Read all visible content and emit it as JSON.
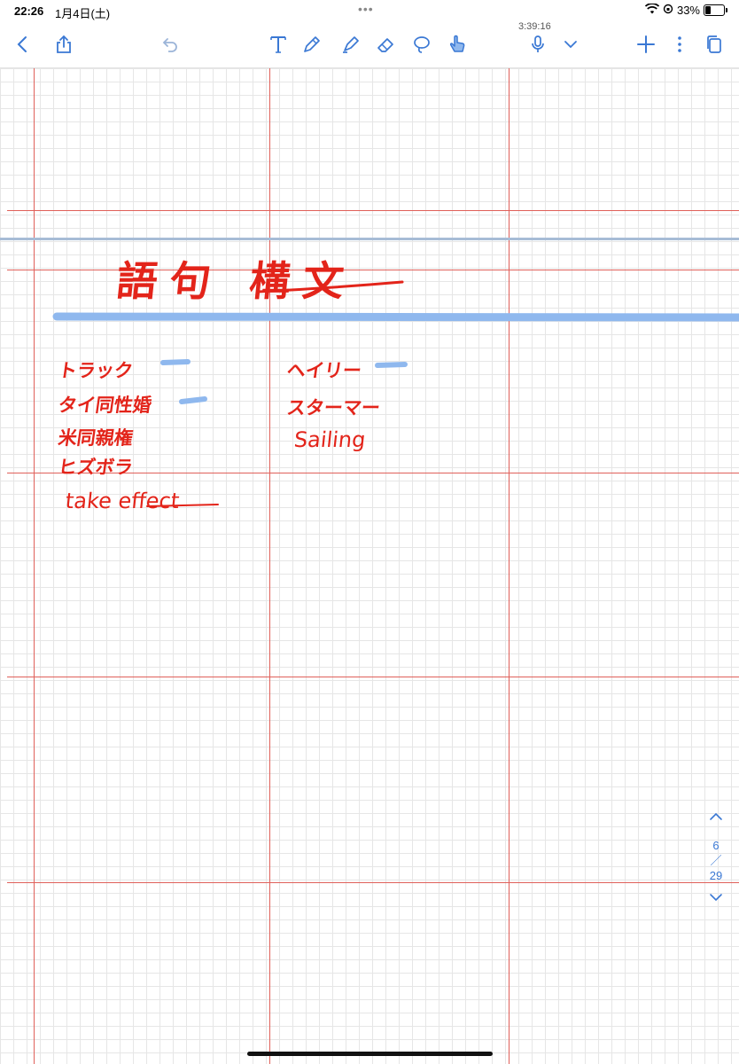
{
  "status_bar": {
    "time": "22:26",
    "date": "1月4日(土)",
    "multitask": "•••",
    "wifi_icon": "wifi-icon",
    "battery_percent": "33%",
    "battery_level": 0.33
  },
  "toolbar": {
    "timer": "3:39:16",
    "left_tools": [
      "back",
      "share",
      "undo"
    ],
    "center_tools": [
      "text",
      "pen",
      "highlighter",
      "eraser",
      "lasso",
      "touch"
    ],
    "right_tools": [
      "microphone",
      "dropdown",
      "add",
      "more",
      "pages"
    ],
    "active_tool": "touch",
    "accent_color": "#3a78d4"
  },
  "page": {
    "title": "語句 構文",
    "items_left": [
      "トラック",
      "タイ同性婚",
      "米同親権",
      "ヒズボラ"
    ],
    "english_item": "take effect",
    "items_right": [
      "ヘイリー",
      "スターマー",
      "Sailing"
    ],
    "ink_color": "#e3241a",
    "highlight_color": "#8fb8ee"
  },
  "pager": {
    "current": "6",
    "separator": "／",
    "total": "29"
  }
}
